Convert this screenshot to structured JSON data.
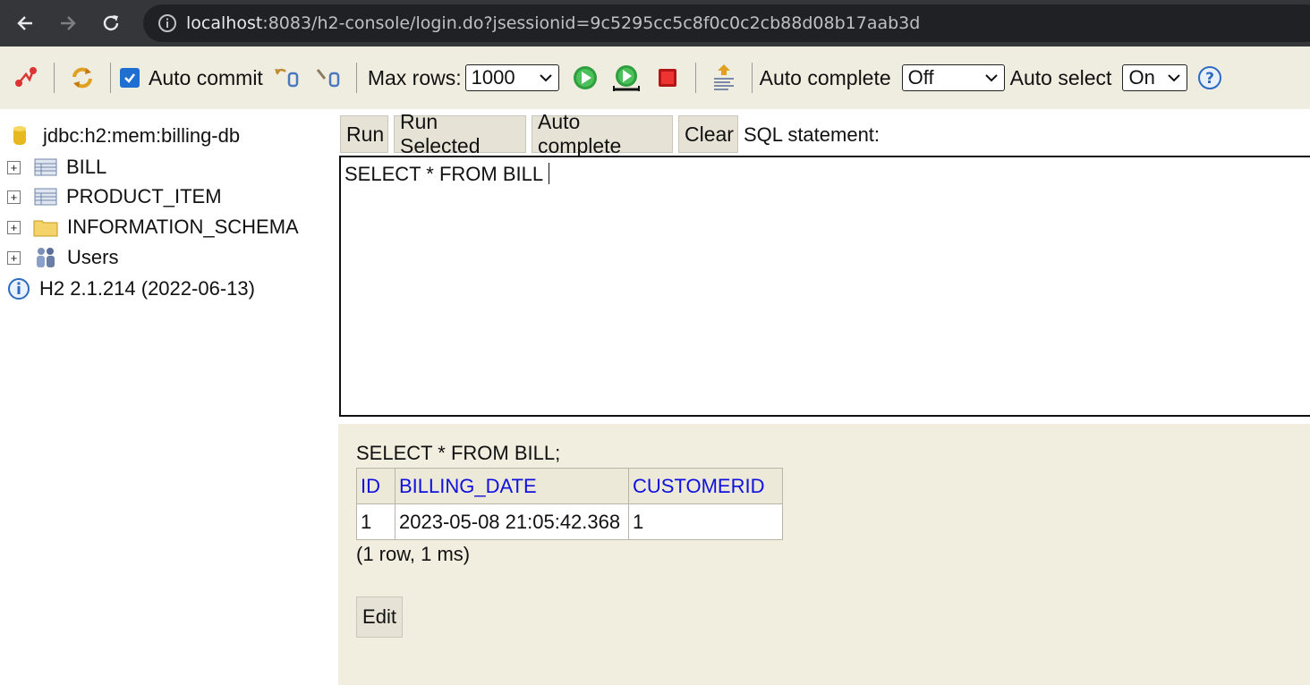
{
  "browser": {
    "url_host": "localhost",
    "url_rest": ":8083/h2-console/login.do?jsessionid=9c5295cc5c8f0c0c2cb88d08b17aab3d"
  },
  "toolbar": {
    "auto_commit_label": "Auto commit",
    "auto_commit_checked": true,
    "max_rows_label": "Max rows:",
    "max_rows_value": "1000",
    "auto_complete_label": "Auto complete",
    "auto_complete_value": "Off",
    "auto_select_label": "Auto select",
    "auto_select_value": "On"
  },
  "tree": {
    "connection": "jdbc:h2:mem:billing-db",
    "items": [
      {
        "label": "BILL",
        "icon": "table-icon"
      },
      {
        "label": "PRODUCT_ITEM",
        "icon": "table-icon"
      },
      {
        "label": "INFORMATION_SCHEMA",
        "icon": "folder-icon"
      },
      {
        "label": "Users",
        "icon": "users-icon"
      }
    ],
    "version": "H2 2.1.214 (2022-06-13)"
  },
  "query": {
    "buttons": {
      "run": "Run",
      "run_selected": "Run Selected",
      "auto_complete": "Auto complete",
      "clear": "Clear"
    },
    "sql_label": "SQL statement:",
    "sql_text": "SELECT * FROM BILL"
  },
  "result": {
    "sql": "SELECT * FROM BILL;",
    "columns": [
      "ID",
      "BILLING_DATE",
      "CUSTOMERID"
    ],
    "rows": [
      [
        "1",
        "2023-05-08 21:05:42.368",
        "1"
      ]
    ],
    "info": "(1 row, 1 ms)",
    "edit_label": "Edit"
  },
  "colors": {
    "toolbar_bg": "#efece0",
    "result_bg": "#f1eedf",
    "header_link": "#1010dd"
  }
}
